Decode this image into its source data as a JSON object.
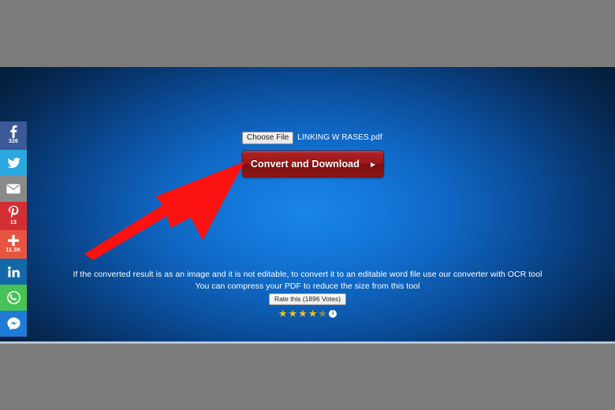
{
  "social_sidebar": {
    "items": [
      {
        "name": "facebook",
        "icon": "facebook-icon",
        "count": "326",
        "color": "#3b5998"
      },
      {
        "name": "twitter",
        "icon": "twitter-icon",
        "count": "",
        "color": "#2ca8e0"
      },
      {
        "name": "email",
        "icon": "envelope-icon",
        "count": "",
        "color": "#8a8a8a"
      },
      {
        "name": "pinterest",
        "icon": "pinterest-icon",
        "count": "13",
        "color": "#d32f33"
      },
      {
        "name": "share",
        "icon": "plus-icon",
        "count": "11.3K",
        "color": "#e8543f"
      },
      {
        "name": "linkedin",
        "icon": "linkedin-icon",
        "count": "",
        "color": "#1369a8"
      },
      {
        "name": "whatsapp",
        "icon": "whatsapp-icon",
        "count": "",
        "color": "#46c354"
      },
      {
        "name": "messenger",
        "icon": "messenger-icon",
        "count": "",
        "color": "#1f7bd6"
      }
    ]
  },
  "upload_form": {
    "choose_file_label": "Choose File",
    "file_name": "LINKING W   RASES.pdf",
    "convert_button_label": "Convert and Download",
    "convert_button_chevron": "▶"
  },
  "footer_notes": {
    "line_1": "If the converted result is as an image and it is not editable, to convert it to an editable word file use our converter with OCR tool",
    "line_2": "You can compress your PDF to reduce the size from this tool"
  },
  "rating": {
    "label": "Rate this (1896 Votes)",
    "votes": "1896",
    "stars_filled": 4,
    "stars_total": 5,
    "badge_text": "i",
    "star_glyph": "★"
  },
  "annotation": {
    "arrow_color": "#fc1111",
    "arrow_points_to": "convert-and-download-button"
  },
  "theme": {
    "background_center": "#1a85e8",
    "background_edge": "#04203f",
    "letterbox": "#7b7b7b",
    "button_red": "#9c1a1a",
    "star_gold": "#f2c018"
  }
}
